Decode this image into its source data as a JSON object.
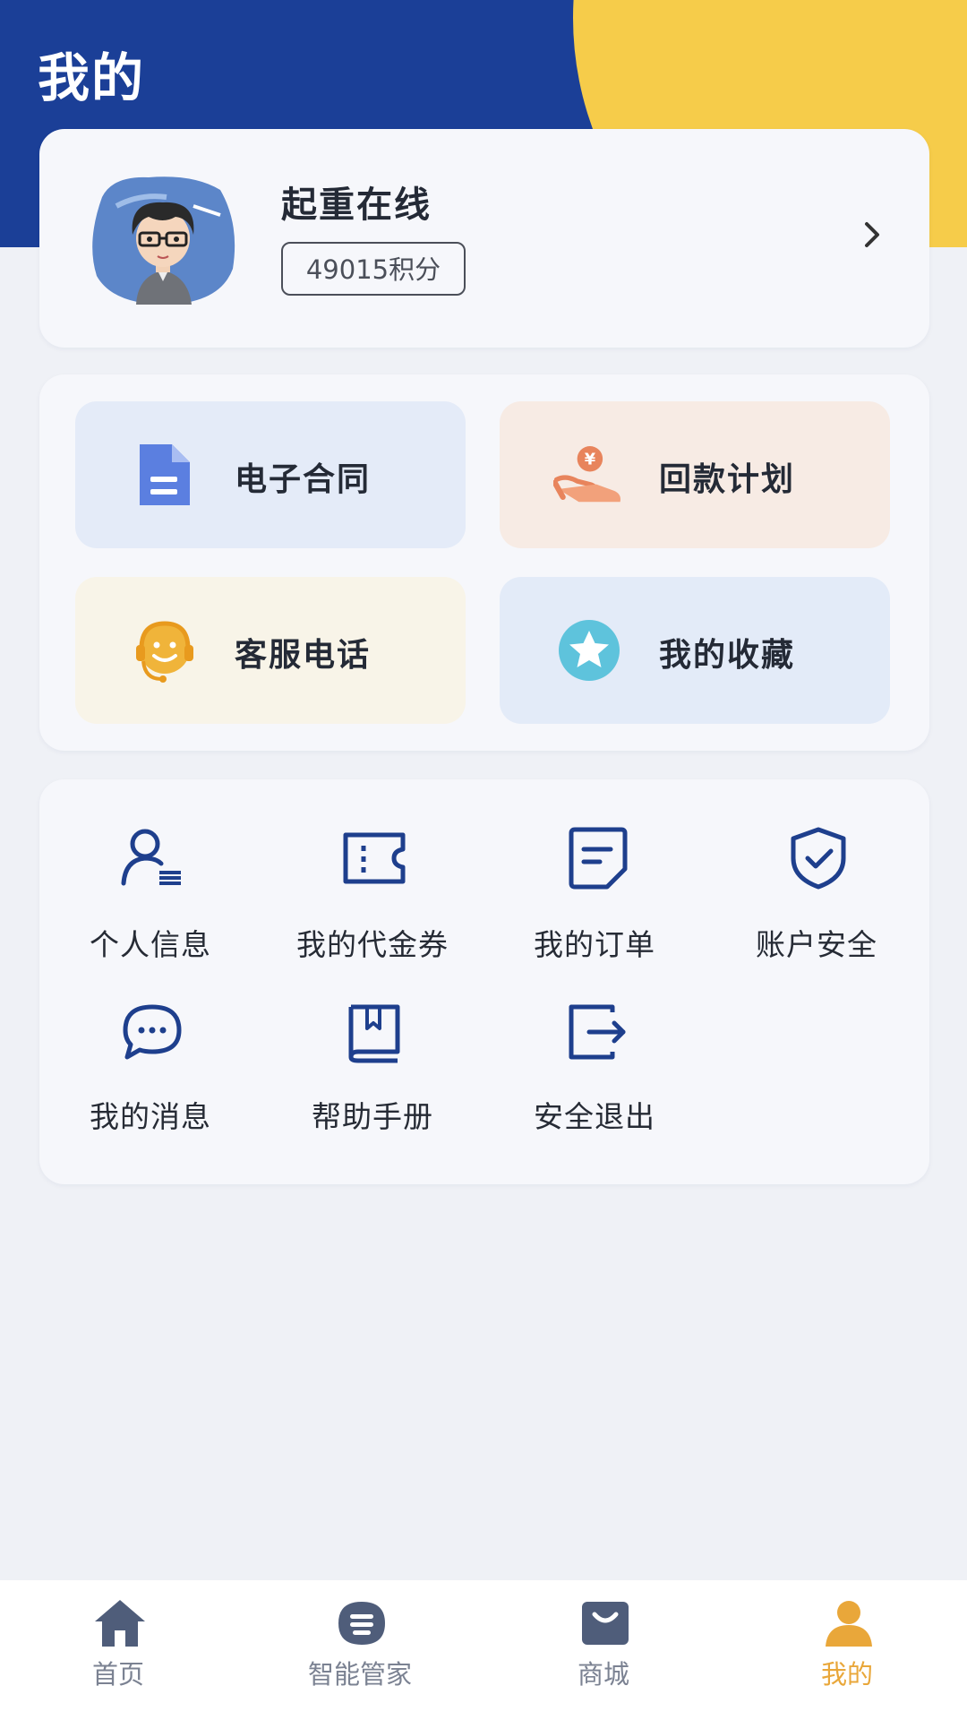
{
  "header": {
    "title": "我的"
  },
  "profile": {
    "name": "起重在线",
    "points": "49015积分"
  },
  "quick_actions": [
    {
      "label": "电子合同",
      "icon": "document-icon"
    },
    {
      "label": "回款计划",
      "icon": "hand-coin-icon"
    },
    {
      "label": "客服电话",
      "icon": "headset-smile-icon"
    },
    {
      "label": "我的收藏",
      "icon": "star-icon"
    }
  ],
  "menu": [
    {
      "label": "个人信息",
      "icon": "user-info-icon"
    },
    {
      "label": "我的代金券",
      "icon": "ticket-icon"
    },
    {
      "label": "我的订单",
      "icon": "order-icon"
    },
    {
      "label": "账户安全",
      "icon": "shield-icon"
    },
    {
      "label": "我的消息",
      "icon": "chat-icon"
    },
    {
      "label": "帮助手册",
      "icon": "book-icon"
    },
    {
      "label": "安全退出",
      "icon": "logout-icon"
    }
  ],
  "tabbar": [
    {
      "label": "首页",
      "icon": "home-icon"
    },
    {
      "label": "智能管家",
      "icon": "assistant-icon"
    },
    {
      "label": "商城",
      "icon": "shop-icon"
    },
    {
      "label": "我的",
      "icon": "user-icon",
      "active": true
    }
  ],
  "colors": {
    "brand_blue": "#1b3f97",
    "accent_yellow": "#f6cc4a",
    "active_tab": "#e9a73a",
    "icon_blue": "#1e3f8d"
  }
}
